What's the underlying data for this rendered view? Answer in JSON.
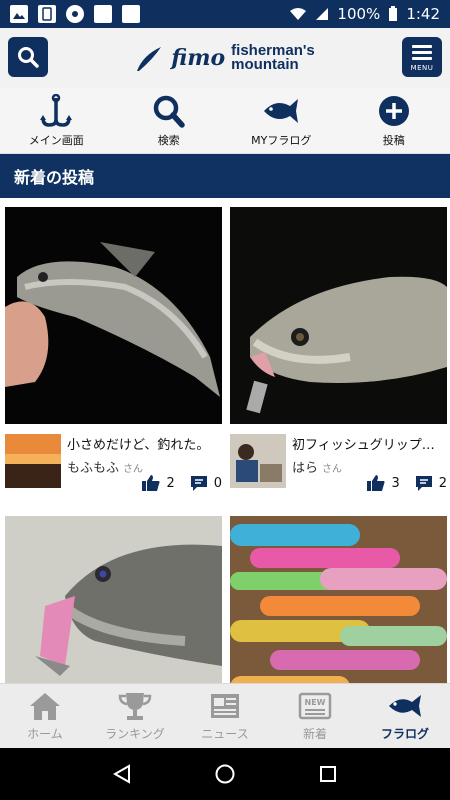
{
  "status_bar": {
    "battery": "100%",
    "time": "1:42"
  },
  "header": {
    "logo_mark": "fimo",
    "logo_line1": "fisherman's",
    "logo_line2": "mountain",
    "menu_label": "MENU"
  },
  "subnav": [
    {
      "label": "メイン画面",
      "icon": "anchor-hook-icon"
    },
    {
      "label": "検索",
      "icon": "search-icon"
    },
    {
      "label": "MYフラログ",
      "icon": "fish-icon"
    },
    {
      "label": "投稿",
      "icon": "plus-circle-icon"
    }
  ],
  "section": {
    "title": "新着の投稿"
  },
  "posts": [
    {
      "title": "小さめだけど、釣れた。",
      "author": "もふもふ",
      "suffix": "さん",
      "likes": "2",
      "comments": "0"
    },
    {
      "title": "初フィッシュグリップ…",
      "author": "はら",
      "suffix": "さん",
      "likes": "3",
      "comments": "2"
    },
    {
      "title": "",
      "author": "",
      "suffix": "",
      "likes": "",
      "comments": ""
    },
    {
      "title": "",
      "author": "",
      "suffix": "",
      "likes": "",
      "comments": ""
    }
  ],
  "bottom_tabs": [
    {
      "label": "ホーム",
      "icon": "home-icon"
    },
    {
      "label": "ランキング",
      "icon": "trophy-icon"
    },
    {
      "label": "ニュース",
      "icon": "newspaper-icon"
    },
    {
      "label": "新着",
      "icon": "new-badge-icon",
      "badge": "NEW"
    },
    {
      "label": "フラログ",
      "icon": "fish-icon",
      "active": true
    }
  ],
  "colors": {
    "navy": "#0f2f5e",
    "section": "#0f3263",
    "inactive": "#999999"
  }
}
